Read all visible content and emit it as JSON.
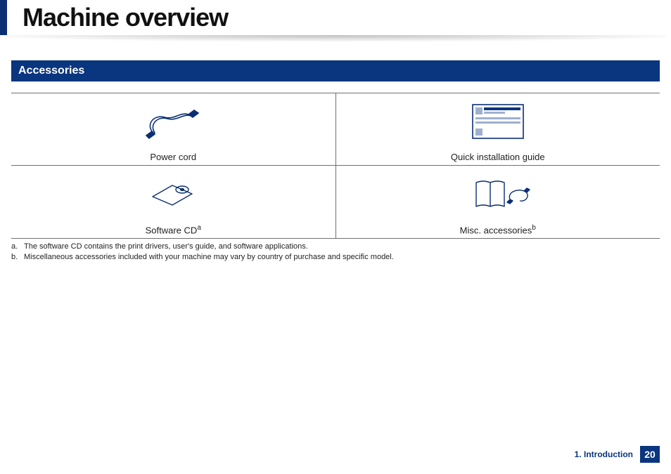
{
  "page": {
    "title": "Machine overview",
    "section_header": "Accessories",
    "chapter_label": "1. Introduction",
    "page_number": "20"
  },
  "accessories": {
    "row1": {
      "left": {
        "label": "Power cord",
        "icon": "power-cord"
      },
      "right": {
        "label": "Quick installation guide",
        "icon": "quick-guide"
      }
    },
    "row2": {
      "left": {
        "label": "Software CD",
        "sup": "a",
        "icon": "software-cd"
      },
      "right": {
        "label": "Misc. accessories",
        "sup": "b",
        "icon": "misc-accessories"
      }
    }
  },
  "footnotes": {
    "a": "The software CD contains the print drivers, user's guide, and software applications.",
    "b": "Miscellaneous accessories included with your machine may vary by country of purchase and specific model."
  }
}
